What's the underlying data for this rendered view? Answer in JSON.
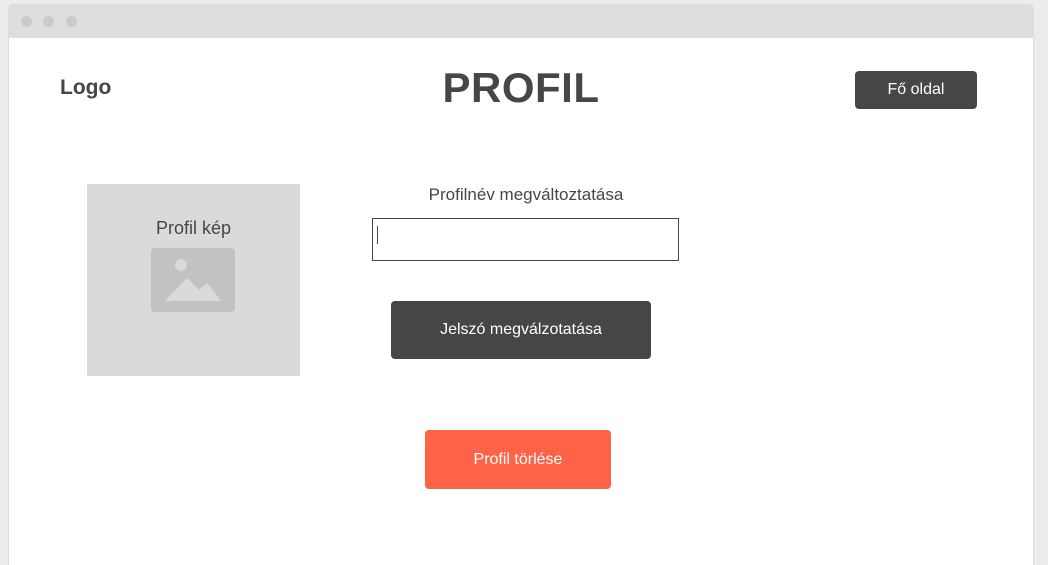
{
  "header": {
    "logo": "Logo",
    "title": "PROFIL",
    "home_button": "Fő oldal"
  },
  "profile": {
    "image_label": "Profil kép",
    "image_icon": "image-placeholder-icon"
  },
  "name_change": {
    "label": "Profilnév megváltoztatása",
    "value": "",
    "placeholder": ""
  },
  "actions": {
    "change_password": "Jelszó megválzotatása",
    "delete_profile": "Profil törlése"
  },
  "colors": {
    "dark": "#464646",
    "danger": "#ff6347",
    "placeholder_bg": "#dadada"
  }
}
